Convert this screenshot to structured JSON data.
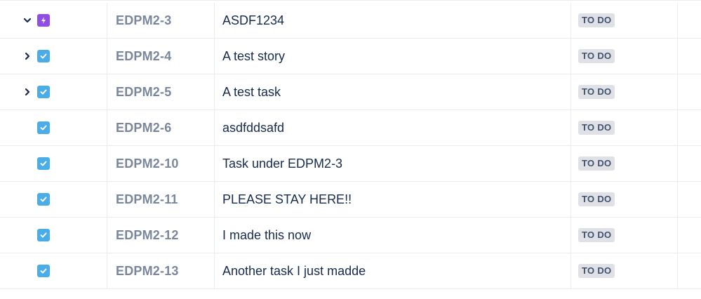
{
  "colors": {
    "epic": "#904ee2",
    "task": "#4bade8",
    "key_text": "#7a869a",
    "summary_text": "#172b4d",
    "status_bg": "#dfe1e6",
    "status_text": "#42526e",
    "divider": "#ebecf0"
  },
  "rows": [
    {
      "toggle": "expanded",
      "type_icon": "lightning-icon",
      "type": "epic",
      "key": "EDPM2-3",
      "summary": "ASDF1234",
      "status": "TO DO"
    },
    {
      "toggle": "collapsed",
      "type_icon": "checkbox-icon",
      "type": "task",
      "key": "EDPM2-4",
      "summary": "A test story",
      "status": "TO DO"
    },
    {
      "toggle": "collapsed",
      "type_icon": "checkbox-icon",
      "type": "task",
      "key": "EDPM2-5",
      "summary": "A test task",
      "status": "TO DO"
    },
    {
      "toggle": "none",
      "type_icon": "checkbox-icon",
      "type": "task",
      "key": "EDPM2-6",
      "summary": "asdfddsafd",
      "status": "TO DO"
    },
    {
      "toggle": "none",
      "type_icon": "checkbox-icon",
      "type": "task",
      "key": "EDPM2-10",
      "summary": "Task under EDPM2-3",
      "status": "TO DO"
    },
    {
      "toggle": "none",
      "type_icon": "checkbox-icon",
      "type": "task",
      "key": "EDPM2-11",
      "summary": "PLEASE STAY HERE!!",
      "status": "TO DO"
    },
    {
      "toggle": "none",
      "type_icon": "checkbox-icon",
      "type": "task",
      "key": "EDPM2-12",
      "summary": "I made this now",
      "status": "TO DO"
    },
    {
      "toggle": "none",
      "type_icon": "checkbox-icon",
      "type": "task",
      "key": "EDPM2-13",
      "summary": "Another task I just madde",
      "status": "TO DO"
    }
  ]
}
